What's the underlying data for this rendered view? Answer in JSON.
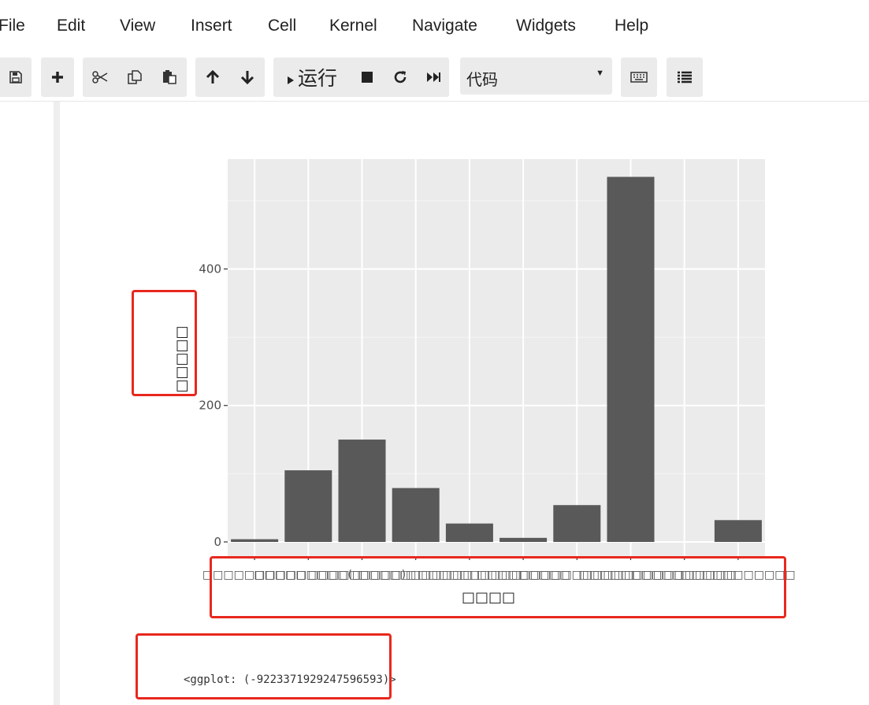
{
  "menu": [
    "File",
    "Edit",
    "View",
    "Insert",
    "Cell",
    "Kernel",
    "Navigate",
    "Widgets",
    "Help"
  ],
  "toolbar": {
    "run_label": "运行",
    "cell_type": "代码",
    "icons": [
      "save-icon",
      "plus-icon",
      "cut-icon",
      "copy-icon",
      "paste-icon",
      "arrow-up-icon",
      "arrow-down-icon",
      "run-icon",
      "stop-icon",
      "restart-icon",
      "fast-forward-icon",
      "keyboard-icon",
      "list-icon"
    ]
  },
  "chart_data": {
    "type": "bar",
    "categories": [
      "□□□□□□□□□□",
      "□□□□□□□□□(□",
      "□□□□□□□□□)□",
      "□□□□□□□□□□□",
      "□□□□□□□□□□",
      "□□□□□□□□□",
      "□□□□□□□□□□□",
      "□□□□□□□□□□",
      "□□□□□□□□□□",
      "□□□□□□□□□□□"
    ],
    "values": [
      4,
      105,
      150,
      79,
      27,
      6,
      54,
      535,
      0,
      32
    ],
    "ylabel": "□□□□□",
    "xlabel": "□□□□",
    "yticks": [
      0,
      200,
      400
    ],
    "ylim": [
      -15,
      560
    ],
    "bar_color": "#595959",
    "panel_color": "#ebebeb",
    "grid": true
  },
  "output_repr": "<ggplot: (-9223371929247596593)>"
}
